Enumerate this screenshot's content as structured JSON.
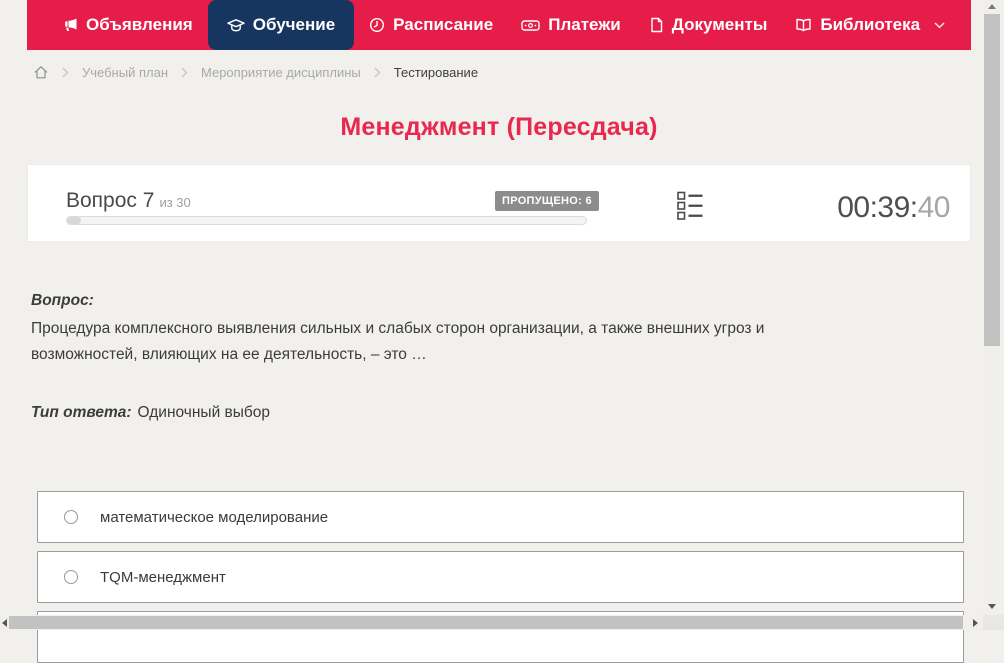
{
  "nav": {
    "items": [
      {
        "label": "Объявления",
        "icon": "megaphone-icon",
        "active": false
      },
      {
        "label": "Обучение",
        "icon": "graduation-cap-icon",
        "active": true
      },
      {
        "label": "Расписание",
        "icon": "clock-icon",
        "active": false
      },
      {
        "label": "Платежи",
        "icon": "banknote-icon",
        "active": false
      },
      {
        "label": "Документы",
        "icon": "document-icon",
        "active": false
      },
      {
        "label": "Библиотека",
        "icon": "book-icon",
        "active": false,
        "has_dropdown": true
      }
    ]
  },
  "breadcrumb": {
    "items": [
      "Учебный план",
      "Мероприятие дисциплины",
      "Тестирование"
    ]
  },
  "page": {
    "title": "Менеджмент (Пересдача)"
  },
  "question_header": {
    "question_label": "Вопрос 7",
    "question_total": "из 30",
    "skipped_badge": "ПРОПУЩЕНО: 6",
    "timer_main": "00:39:",
    "timer_seconds": "40"
  },
  "question": {
    "label": "Вопрос:",
    "text": "Процедура комплексного выявления сильных и слабых сторон организации, а также внешних угроз и возможностей, влияющих на ее деятельность, – это …",
    "answer_type_label": "Тип ответа:",
    "answer_type_value": "Одиночный выбор"
  },
  "options": [
    {
      "label": "математическое моделирование",
      "selected": false
    },
    {
      "label": "TQM-менеджмент",
      "selected": false
    }
  ],
  "colors": {
    "nav_bg": "#e71d49",
    "nav_active_bg": "#16365f",
    "page_bg": "#f1f0ed",
    "title_color": "#e8284e",
    "badge_bg": "#8c8c8c",
    "card_bg": "#ffffff",
    "option_border": "#9c9c9c",
    "scrollbar_thumb": "#c2c2c2"
  }
}
